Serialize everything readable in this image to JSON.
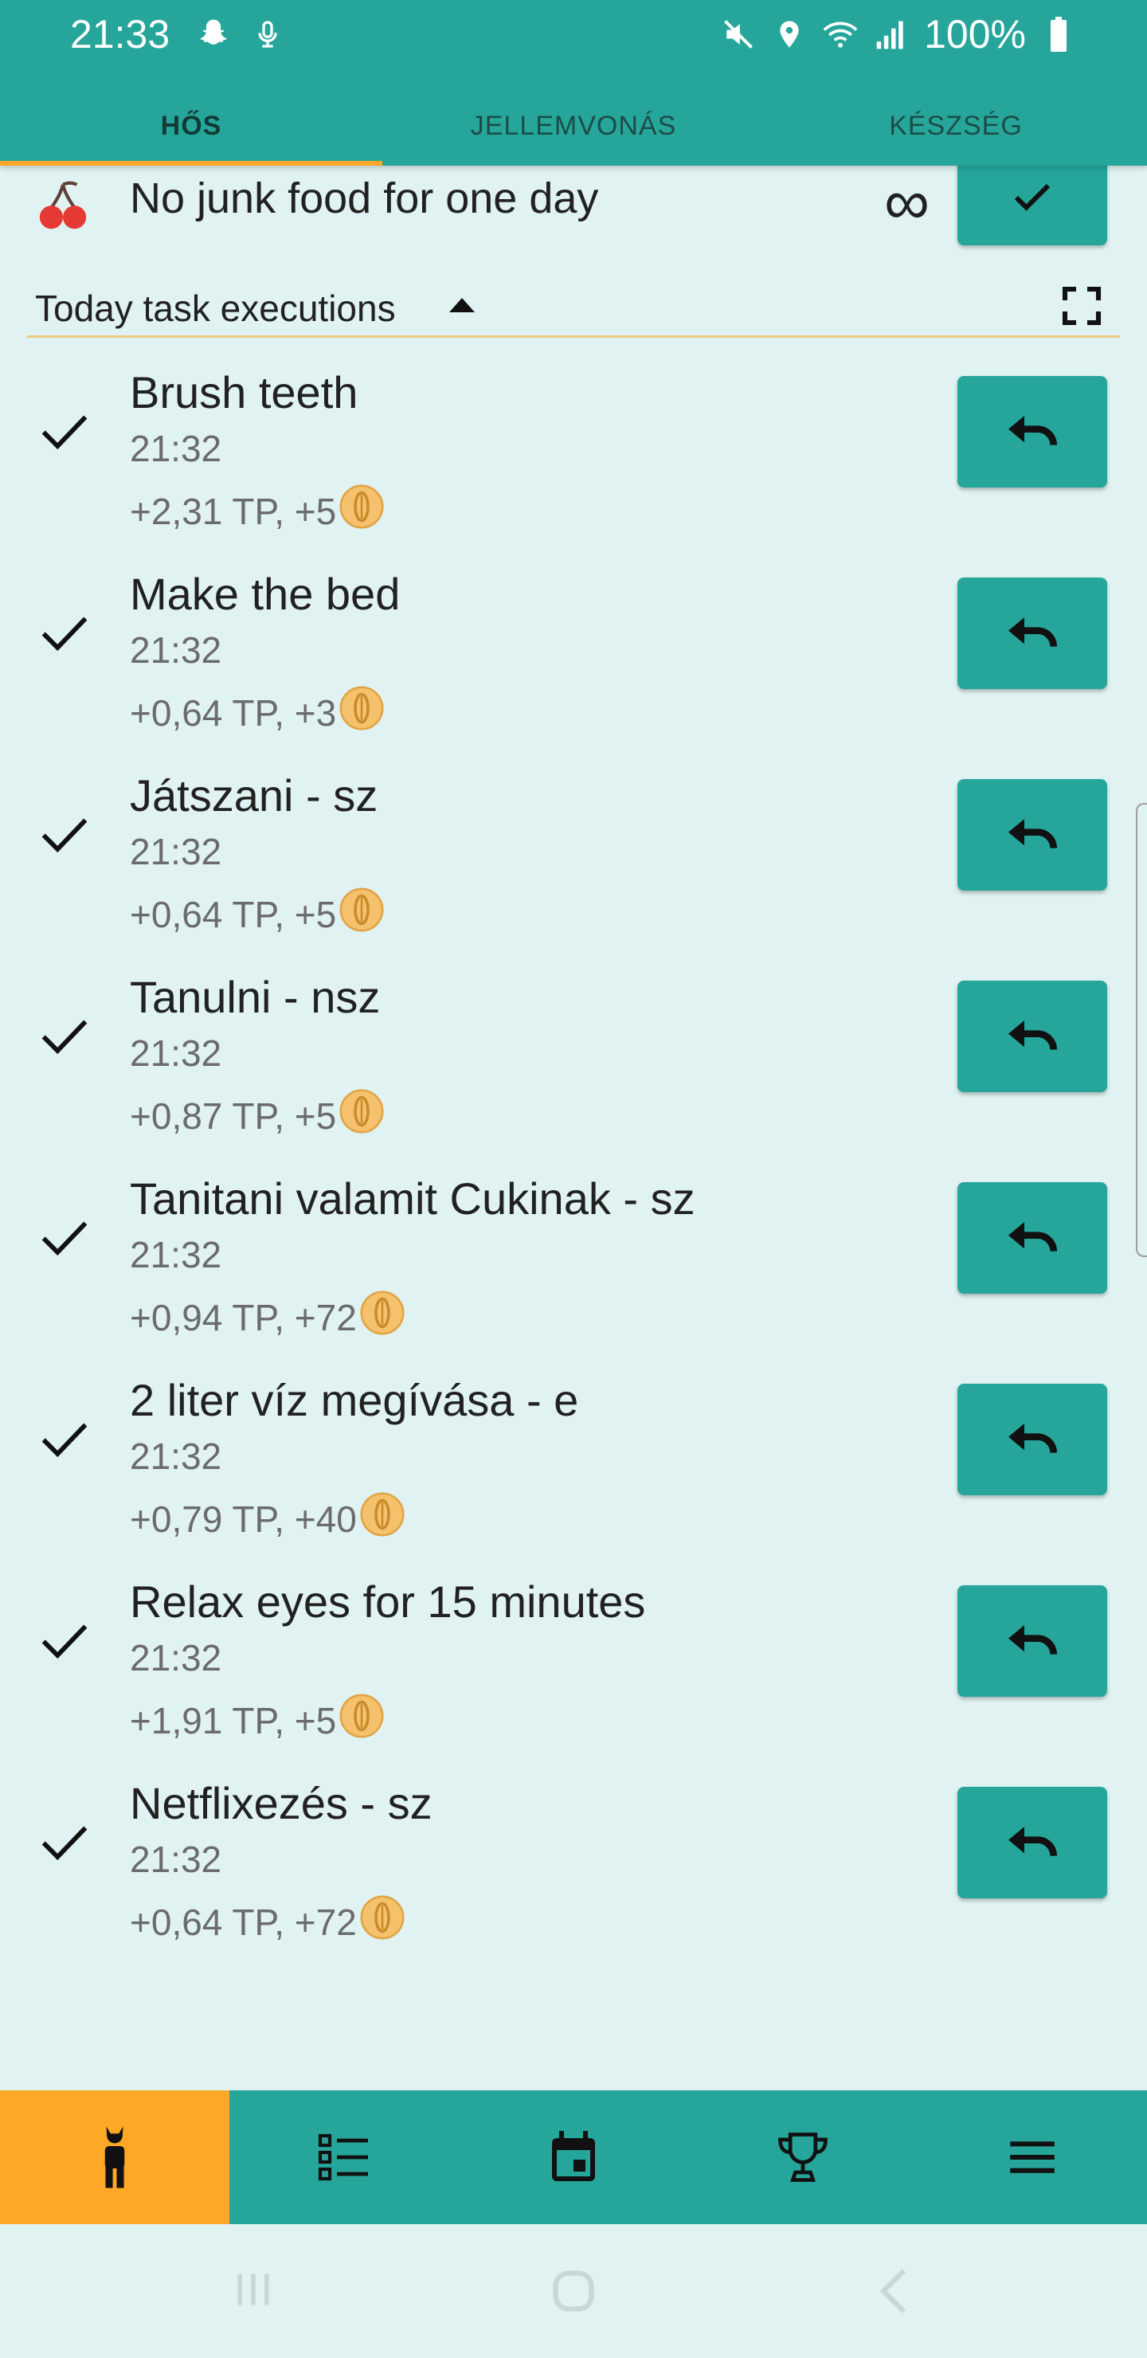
{
  "status_bar": {
    "time": "21:33",
    "battery": "100%",
    "icons": [
      "snapchat-ghost-icon",
      "microphone-icon",
      "mute-icon",
      "location-icon",
      "wifi-icon",
      "signal-icon",
      "battery-icon"
    ]
  },
  "tabs": [
    {
      "label": "HŐS",
      "active": true
    },
    {
      "label": "JELLEMVONÁS",
      "active": false
    },
    {
      "label": "KÉSZSÉG",
      "active": false
    }
  ],
  "partial_task": {
    "title": "No junk food for one day",
    "infinity": "∞",
    "icon": "cherry-icon"
  },
  "section": {
    "title": "Today task executions"
  },
  "tasks": [
    {
      "title": "Brush teeth",
      "time": "21:32",
      "reward": "+2,31 TP, +5"
    },
    {
      "title": "Make the bed",
      "time": "21:32",
      "reward": "+0,64 TP, +3"
    },
    {
      "title": "Játszani - sz",
      "time": "21:32",
      "reward": "+0,64 TP, +5"
    },
    {
      "title": "Tanulni - nsz",
      "time": "21:32",
      "reward": "+0,87 TP, +5"
    },
    {
      "title": "Tanitani valamit Cukinak - sz",
      "time": "21:32",
      "reward": "+0,94 TP, +72"
    },
    {
      "title": "2 liter víz megívása - e",
      "time": "21:32",
      "reward": "+0,79 TP, +40"
    },
    {
      "title": "Relax eyes for 15 minutes",
      "time": "21:32",
      "reward": "+1,91 TP, +5"
    },
    {
      "title": "Netflixezés - sz",
      "time": "21:32",
      "reward": "+0,64 TP, +72"
    }
  ],
  "bottom_nav": [
    "hero-icon",
    "task-list-icon",
    "calendar-icon",
    "trophy-icon",
    "menu-icon"
  ],
  "colors": {
    "primary": "#26a69a",
    "accent": "#ffa726",
    "background": "#e0f2f1"
  }
}
